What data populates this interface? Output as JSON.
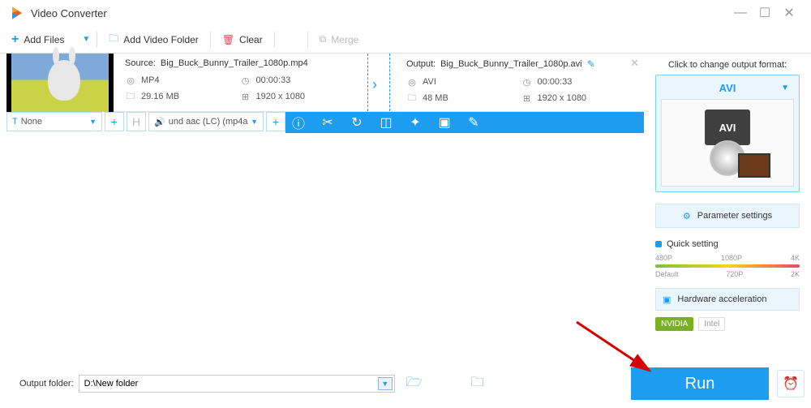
{
  "titlebar": {
    "title": "Video Converter"
  },
  "toolbar": {
    "addFiles": "Add Files",
    "addFolder": "Add Video Folder",
    "clear": "Clear",
    "merge": "Merge"
  },
  "file": {
    "sourceLabel": "Source:",
    "sourceName": "Big_Buck_Bunny_Trailer_1080p.mp4",
    "srcFormat": "MP4",
    "srcDuration": "00:00:33",
    "srcSize": "29.16 MB",
    "srcRes": "1920 x 1080",
    "outputLabel": "Output:",
    "outputName": "Big_Buck_Bunny_Trailer_1080p.avi",
    "outFormat": "AVI",
    "outDuration": "00:00:33",
    "outSize": "48 MB",
    "outRes": "1920 x 1080"
  },
  "controls": {
    "subtitle": "None",
    "hBtn": "H",
    "audio": "und aac (LC) (mp4a"
  },
  "right": {
    "title": "Click to change output format:",
    "format": "AVI",
    "formatCard": "AVI",
    "param": "Parameter settings",
    "quick": "Quick setting",
    "ticks": {
      "t1": "480P",
      "t2": "1080P",
      "t3": "4K",
      "b1": "Default",
      "b2": "720P",
      "b3": "2K"
    },
    "hw": "Hardware acceleration",
    "nvidia": "NVIDIA",
    "intel": "Intel"
  },
  "bottom": {
    "label": "Output folder:",
    "path": "D:\\New folder",
    "run": "Run"
  }
}
